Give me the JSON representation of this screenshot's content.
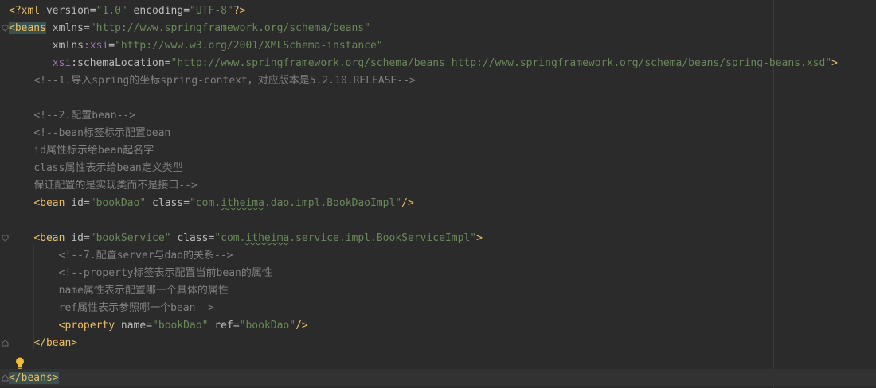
{
  "editor": {
    "language": "XML",
    "lines": [
      "<?xml version=\"1.0\" encoding=\"UTF-8\"?>",
      "<beans xmlns=\"http://www.springframework.org/schema/beans\"",
      "       xmlns:xsi=\"http://www.w3.org/2001/XMLSchema-instance\"",
      "       xsi:schemaLocation=\"http://www.springframework.org/schema/beans http://www.springframework.org/schema/beans/spring-beans.xsd\">",
      "    <!--1.导入spring的坐标spring-context，对应版本是5.2.10.RELEASE-->",
      "",
      "    <!--2.配置bean-->",
      "    <!--bean标签标示配置bean",
      "    id属性标示给bean起名字",
      "    class属性表示给bean定义类型",
      "    保证配置的是实现类而不是接口-->",
      "    <bean id=\"bookDao\" class=\"com.itheima.dao.impl.BookDaoImpl\"/>",
      "",
      "    <bean id=\"bookService\" class=\"com.itheima.service.impl.BookServiceImpl\">",
      "        <!--7.配置server与dao的关系-->",
      "        <!--property标签表示配置当前bean的属性",
      "        name属性表示配置哪一个具体的属性",
      "        ref属性表示参照哪一个bean-->",
      "        <property name=\"bookDao\" ref=\"bookDao\"/>",
      "    </bean>",
      "",
      "</beans>"
    ],
    "tokens": {
      "l1": {
        "pi_open": "<?xml",
        "a1": " version",
        "v1": "\"1.0\"",
        "a2": " encoding",
        "v2": "\"UTF-8\"",
        "pi_close": "?>"
      },
      "l2": {
        "tag": "<beans",
        "attr": " xmlns",
        "val": "\"http://www.springframework.org/schema/beans\""
      },
      "l3": {
        "indent": "       ",
        "attr": "xmlns",
        "ns": ":xsi",
        "val": "\"http://www.w3.org/2001/XMLSchema-instance\""
      },
      "l4": {
        "indent": "       ",
        "ns": "xsi",
        "attr": ":schemaLocation",
        "val": "\"http://www.springframework.org/schema/beans http://www.springframework.org/schema/beans/spring-beans.xsd\"",
        "close": ">"
      },
      "l5": "<!--1.导入spring的坐标spring-context，对应版本是5.2.10.RELEASE-->",
      "l7": "<!--2.配置bean-->",
      "l8": "<!--bean标签标示配置bean",
      "l9": "id属性标示给bean起名字",
      "l10": "class属性表示给bean定义类型",
      "l11": "保证配置的是实现类而不是接口-->",
      "l12": {
        "tag": "<bean",
        "a1": " id",
        "v1": "\"bookDao\"",
        "a2": " class",
        "v2a": "\"com.",
        "v2b": "itheima",
        "v2c": ".dao.impl.BookDaoImpl\"",
        "close": "/>"
      },
      "l14": {
        "tag": "<bean",
        "a1": " id",
        "v1": "\"bookService\"",
        "a2": " class",
        "v2a": "\"com.",
        "v2b": "itheima",
        "v2c": ".service.impl.BookServiceImpl\"",
        "close": ">"
      },
      "l15": "<!--7.配置server与dao的关系-->",
      "l16": "<!--property标签表示配置当前bean的属性",
      "l17": "name属性表示配置哪一个具体的属性",
      "l18": "ref属性表示参照哪一个bean-->",
      "l19": {
        "tag": "<property",
        "a1": " name",
        "v1": "\"bookDao\"",
        "a2": " ref",
        "v2": "\"bookDao\"",
        "close": "/>"
      },
      "l20": "</bean>",
      "l22": "</beans>"
    },
    "eq": "=",
    "indent4": "    ",
    "indent8": "        ",
    "colors": {
      "background": "#2b2b2b",
      "tag": "#e8bf6a",
      "attribute": "#bababa",
      "namespace": "#9876aa",
      "string": "#6a8759",
      "comment": "#808080",
      "text": "#a9b7c6",
      "tag_match_highlight": "#3b514d"
    },
    "icons": [
      "fold-icon",
      "lightbulb-icon"
    ]
  }
}
